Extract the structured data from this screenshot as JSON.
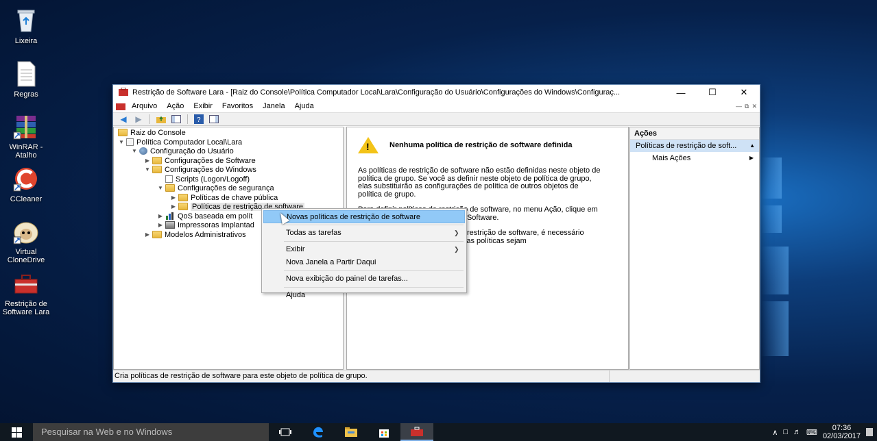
{
  "desktop": {
    "icons": [
      {
        "label": "Lixeira"
      },
      {
        "label": "Regras"
      },
      {
        "label": "WinRAR - Atalho"
      },
      {
        "label": "CCleaner"
      },
      {
        "label": "Virtual CloneDrive"
      },
      {
        "label": "Restrição de Software Lara"
      }
    ]
  },
  "window": {
    "title": "Restrição de Software Lara - [Raiz do Console\\Política Computador Local\\Lara\\Configuração do Usuário\\Configurações do Windows\\Configuraç...",
    "menu": [
      "Arquivo",
      "Ação",
      "Exibir",
      "Favoritos",
      "Janela",
      "Ajuda"
    ]
  },
  "tree": [
    {
      "label": "Raiz do Console"
    },
    {
      "label": "Política Computador Local\\Lara"
    },
    {
      "label": "Configuração do Usuário"
    },
    {
      "label": "Configurações de Software"
    },
    {
      "label": "Configurações do Windows"
    },
    {
      "label": "Scripts (Logon/Logoff)"
    },
    {
      "label": "Configurações de segurança"
    },
    {
      "label": "Políticas de chave pública"
    },
    {
      "label": "Políticas de restrição de software"
    },
    {
      "label": "QoS baseada em polít"
    },
    {
      "label": "Impressoras Implantad"
    },
    {
      "label": "Modelos Administrativos"
    }
  ],
  "center": {
    "heading": "Nenhuma política de restrição de software definida",
    "p1": "As políticas de restrição de software não estão definidas neste objeto de política de grupo. Se você as definir neste objeto de política de grupo, elas substituirão as configurações de política de outros objetos de política de grupo.",
    "p2": "Para definir políticas de restrição de software, no menu Ação, clique em Novas Políticas de Restrição de Software.",
    "p3": "Depois de definir as políticas de restrição de software, é necessário reiniciar o computador para que as políticas sejam"
  },
  "actions": {
    "header": "Ações",
    "selected": "Políticas de restrição de soft...",
    "more": "Mais Ações"
  },
  "context_menu": {
    "items": [
      {
        "label": "Novas políticas de restrição de software"
      },
      {
        "label": "Todas as tarefas"
      },
      {
        "label": "Exibir"
      },
      {
        "label": "Nova Janela a Partir Daqui"
      },
      {
        "label": "Nova exibição do painel de tarefas..."
      },
      {
        "label": "Ajuda"
      }
    ]
  },
  "status": {
    "text": "Cria políticas de restrição de software para este objeto de política de grupo."
  },
  "taskbar": {
    "search_placeholder": "Pesquisar na Web e no Windows",
    "time": "07:36",
    "date": "02/03/2017"
  }
}
